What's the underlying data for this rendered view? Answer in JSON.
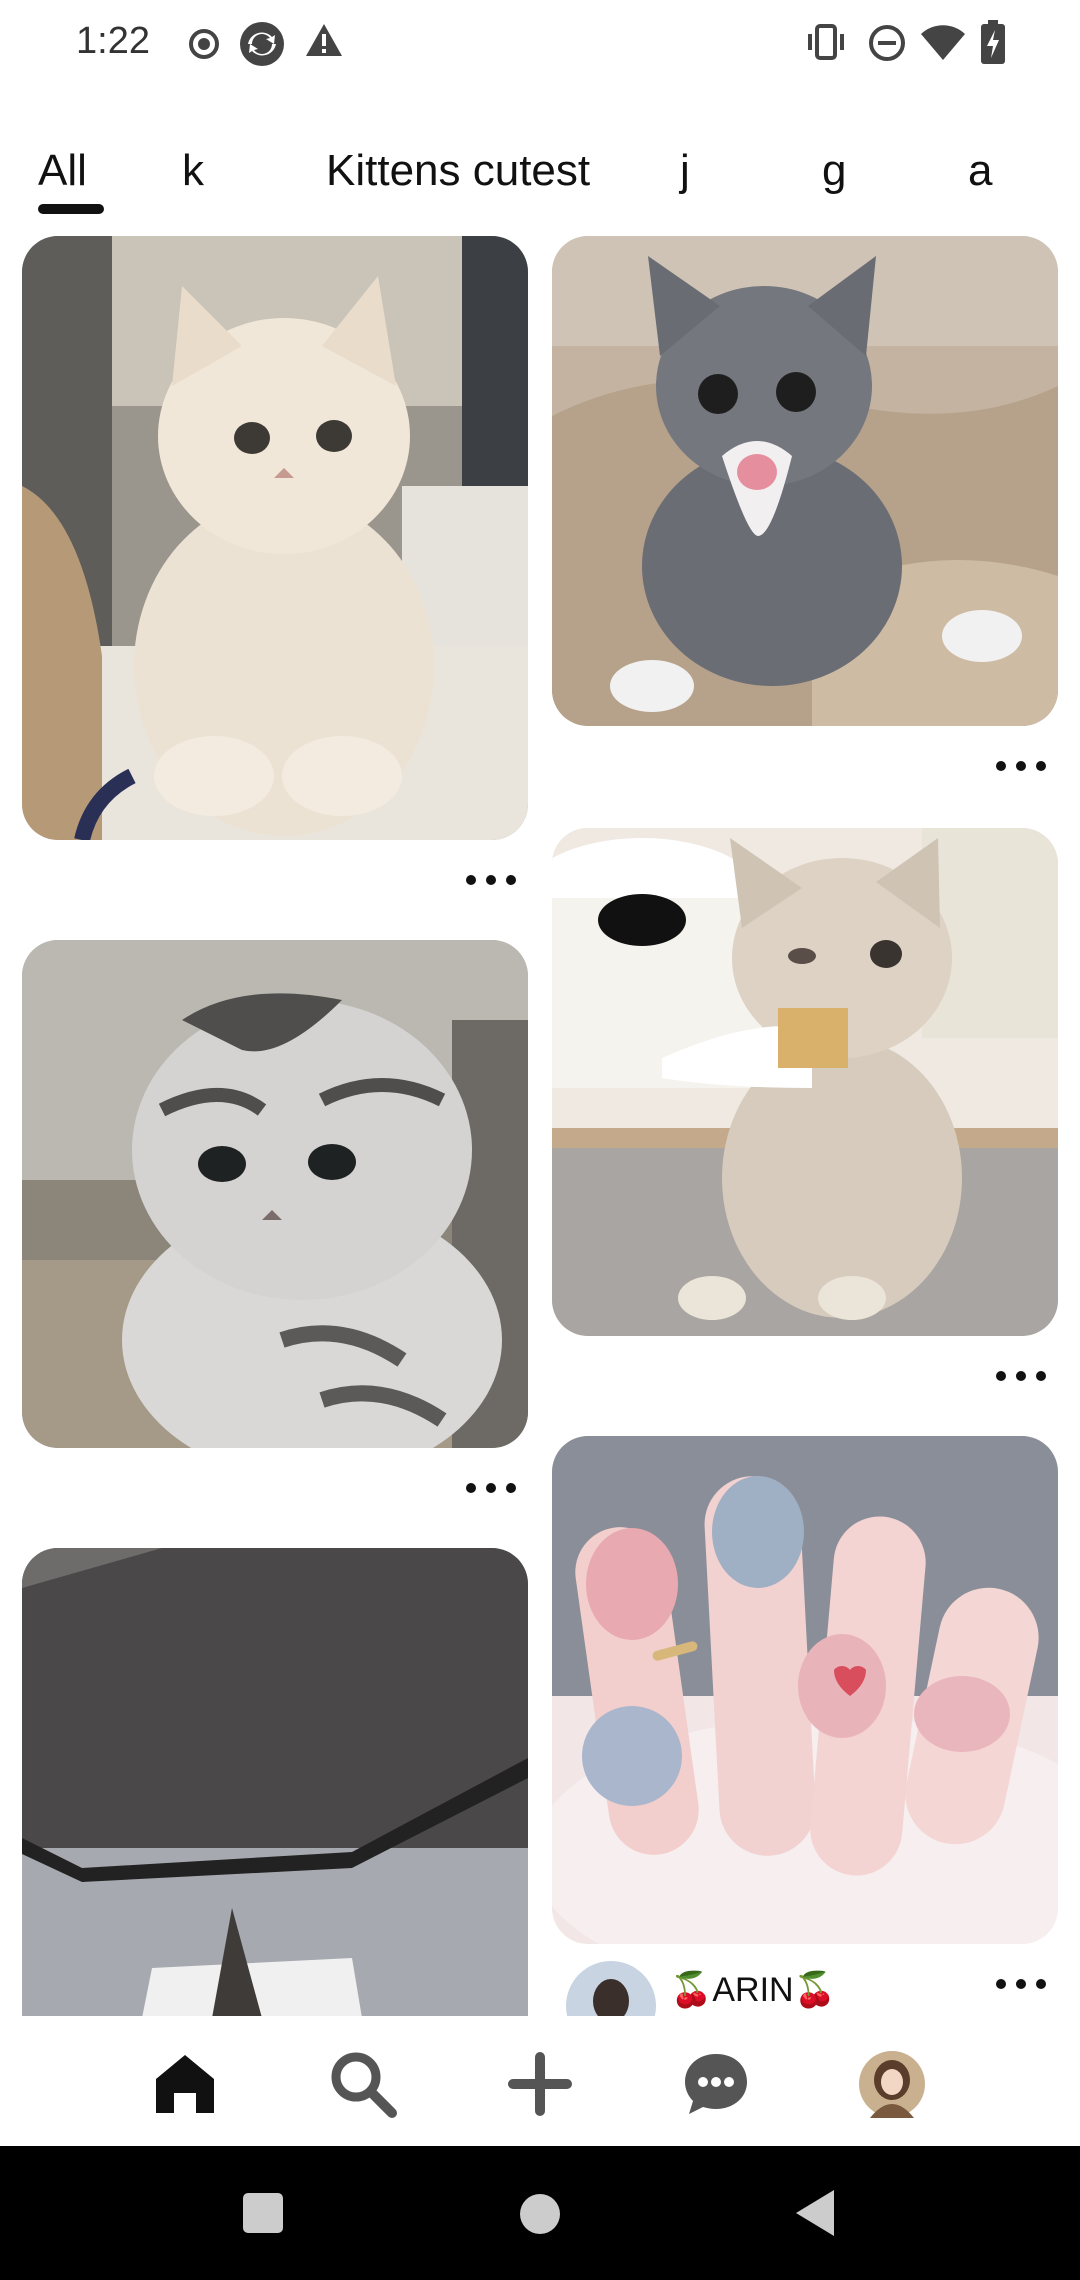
{
  "status_bar": {
    "time": "1:22",
    "left_icons": [
      "record-icon",
      "sync-icon",
      "warning-icon"
    ],
    "right_icons": [
      "vibrate-icon",
      "dnd-icon",
      "wifi-icon",
      "battery-icon"
    ]
  },
  "tabs": [
    {
      "label": "All",
      "selected": true
    },
    {
      "label": "k",
      "selected": false
    },
    {
      "label": "Kittens cutest",
      "selected": false
    },
    {
      "label": "j",
      "selected": false
    },
    {
      "label": "g",
      "selected": false
    },
    {
      "label": "a",
      "selected": false
    }
  ],
  "pins": [
    {
      "name": "fluffy white kitten standing"
    },
    {
      "name": "gray kitten tongue out"
    },
    {
      "name": "cream kitten with bow"
    },
    {
      "name": "scottish fold tabby kitten"
    },
    {
      "name": "pink nails manicure",
      "user": "🍒ARIN🍒"
    },
    {
      "name": "gray room floor"
    }
  ],
  "bottom_nav": {
    "items": [
      "home-icon",
      "search-icon",
      "add-icon",
      "messages-icon",
      "profile-avatar"
    ]
  },
  "colors": {
    "accent": "#111111",
    "background": "#ffffff"
  }
}
